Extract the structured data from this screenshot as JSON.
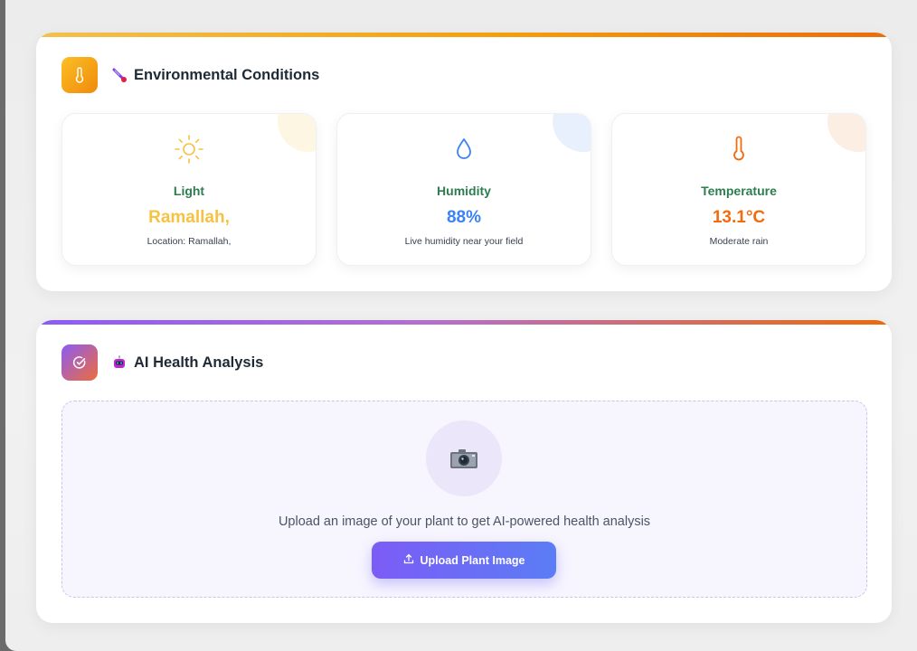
{
  "environment": {
    "title": "Environmental Conditions",
    "header_icon": "thermometer-icon",
    "header_emoji": "thermometer-emoji-icon",
    "stats": [
      {
        "icon": "sun-icon",
        "label": "Light",
        "value": "Ramallah,",
        "sub": "Location: Ramallah,",
        "color": "#f5c242",
        "corner_color": "#fdf6e3"
      },
      {
        "icon": "droplet-icon",
        "label": "Humidity",
        "value": "88%",
        "sub": "Live humidity near your field",
        "color": "#3b82f6",
        "corner_color": "#e8f0fd"
      },
      {
        "icon": "thermometer-icon",
        "label": "Temperature",
        "value": "13.1°C",
        "sub": "Moderate rain",
        "color": "#f26b0f",
        "corner_color": "#fdeee3"
      }
    ]
  },
  "ai_analysis": {
    "title": "AI Health Analysis",
    "header_icon": "check-circle-icon",
    "header_emoji": "robot-icon",
    "prompt": "Upload an image of your plant to get AI-powered health analysis",
    "upload_label": "Upload Plant Image",
    "upload_icon": "upload-icon",
    "camera_icon": "camera-icon"
  },
  "colors": {
    "label_green": "#2e7d4f",
    "accent_purple": "#7c5cf6",
    "accent_orange": "#f08a0c"
  }
}
